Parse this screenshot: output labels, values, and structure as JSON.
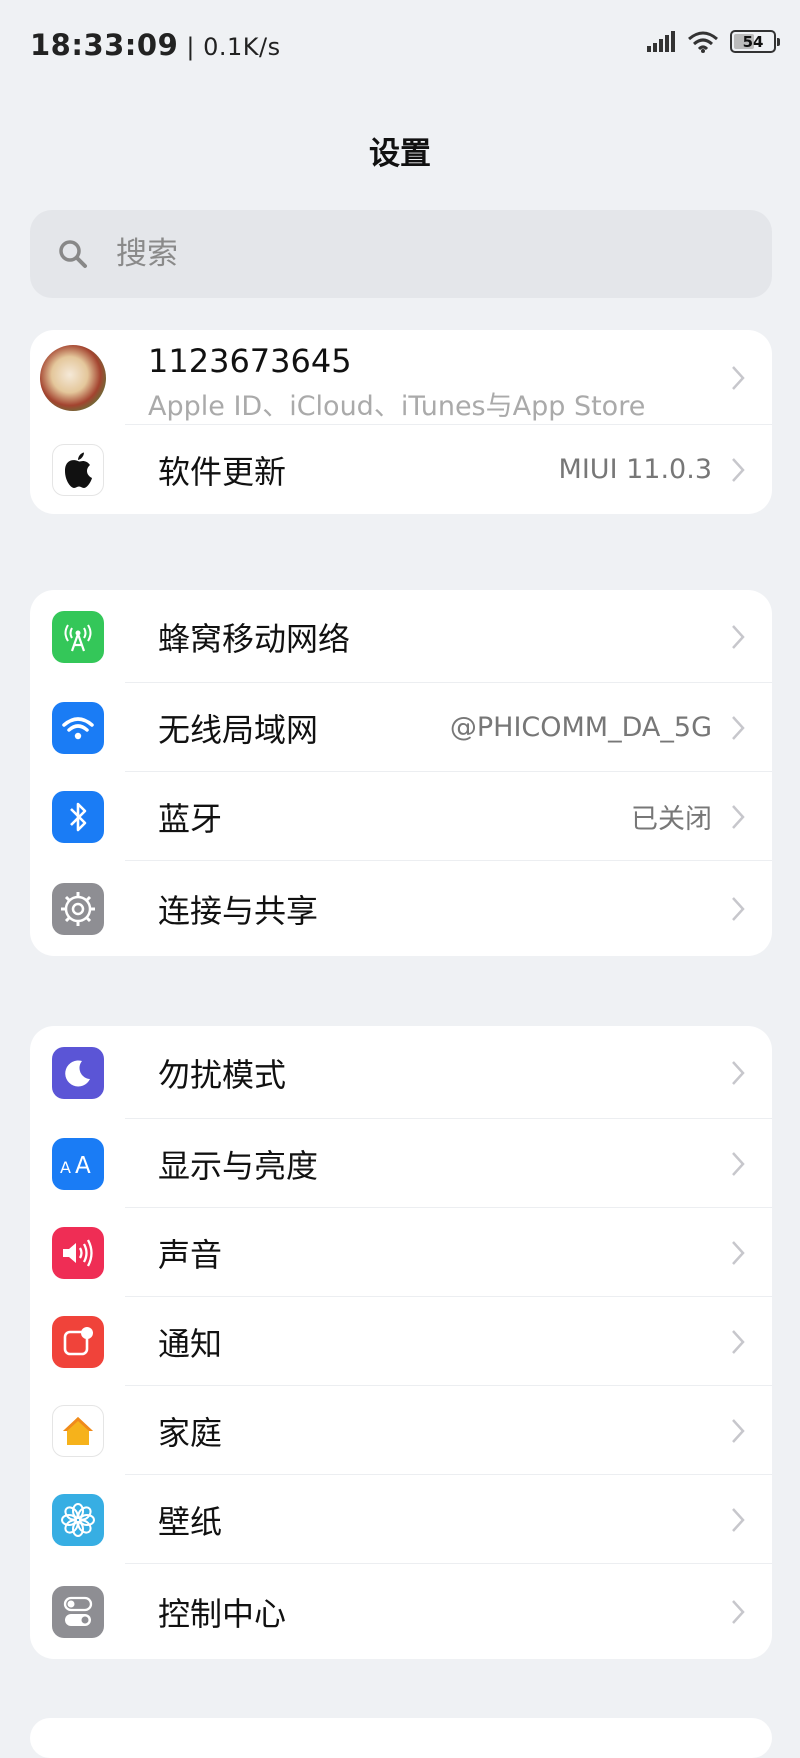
{
  "status": {
    "time": "18:33:09",
    "speed": "0.1K/s",
    "battery": "54",
    "battery_level": 0.54
  },
  "title": "设置",
  "search": {
    "placeholder": "搜索"
  },
  "account": {
    "name": "1123673645",
    "subtitle": "Apple ID、iCloud、iTunes与App Store"
  },
  "software_update": {
    "label": "软件更新",
    "value": "MIUI 11.0.3"
  },
  "network": {
    "cellular": {
      "label": "蜂窝移动网络"
    },
    "wifi": {
      "label": "无线局域网",
      "value": "@PHICOMM_DA_5G"
    },
    "bluetooth": {
      "label": "蓝牙",
      "value": "已关闭"
    },
    "sharing": {
      "label": "连接与共享"
    }
  },
  "general": {
    "dnd": {
      "label": "勿扰模式"
    },
    "display": {
      "label": "显示与亮度"
    },
    "sound": {
      "label": "声音"
    },
    "notifications": {
      "label": "通知"
    },
    "home": {
      "label": "家庭"
    },
    "wallpaper": {
      "label": "壁纸"
    },
    "control": {
      "label": "控制中心"
    }
  },
  "icons": {
    "cellular": "cellular-icon",
    "wifi": "wifi-icon",
    "bluetooth": "bluetooth-icon",
    "sharing": "gear-icon",
    "dnd": "moon-icon",
    "display": "text-size-icon",
    "sound": "speaker-icon",
    "notifications": "notification-icon",
    "home": "house-icon",
    "wallpaper": "flower-icon",
    "control": "toggle-icon"
  },
  "colors": {
    "cellular": "#34c759",
    "wifi": "#1a7cf5",
    "bluetooth": "#1a7cf5",
    "sharing": "#8e8e93",
    "dnd": "#5b55d6",
    "display": "#1a7cf5",
    "sound": "#ef2d55",
    "notifications": "#f0433a",
    "home": "#ffffff",
    "wallpaper": "#37aee3",
    "control": "#8e8e93"
  }
}
